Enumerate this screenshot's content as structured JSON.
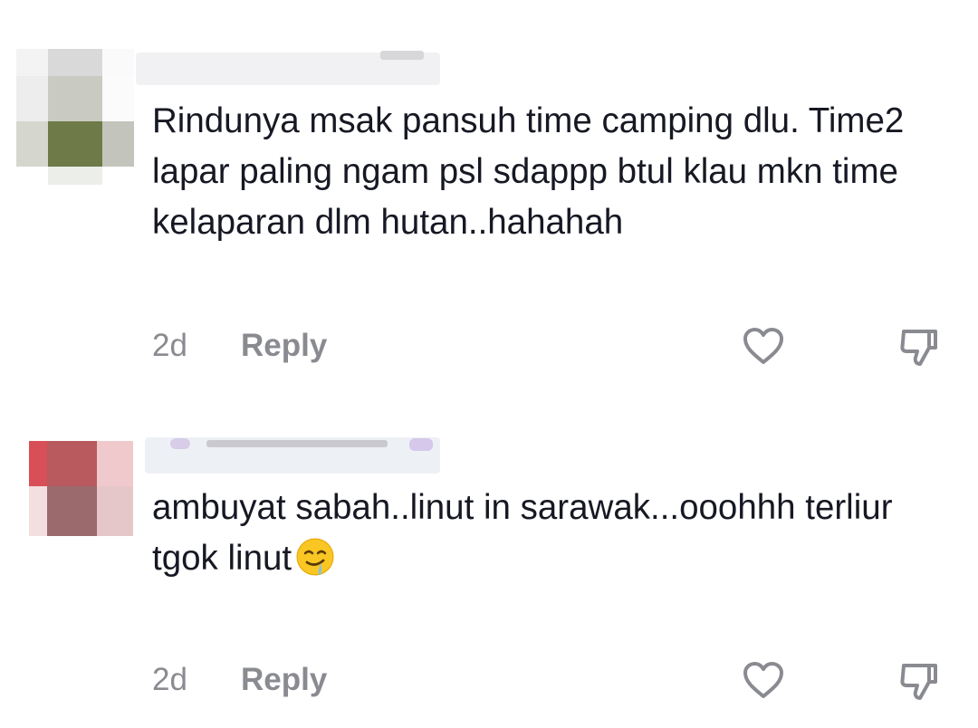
{
  "comments": [
    {
      "username": "",
      "text": "Rindunya msak pansuh time camping dlu. Time2 lapar paling ngam psl sdappp btul klau mkn time kelaparan dlm hutan..hahahah",
      "time": "2d",
      "reply_label": "Reply",
      "icons": [
        "heart-icon",
        "thumbs-down-icon"
      ]
    },
    {
      "username": "",
      "text": "ambuyat sabah..linut in sarawak...ooohhh terliur tgok linut",
      "emoji": "drooling-face-emoji",
      "time": "2d",
      "reply_label": "Reply",
      "icons": [
        "heart-icon",
        "thumbs-down-icon"
      ]
    }
  ],
  "colors": {
    "text": "#161823",
    "meta": "#8a8b91",
    "background": "#ffffff"
  }
}
